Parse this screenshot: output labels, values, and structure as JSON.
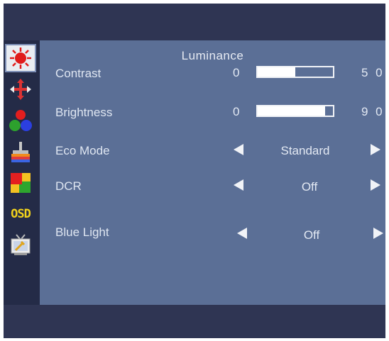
{
  "menu": {
    "title": "Luminance",
    "sidebar": [
      {
        "icon": "luminance-sun-icon",
        "active": true
      },
      {
        "icon": "position-arrows-icon",
        "active": false
      },
      {
        "icon": "color-balls-icon",
        "active": false
      },
      {
        "icon": "picture-adjust-icon",
        "active": false
      },
      {
        "icon": "color-squares-icon",
        "active": false
      },
      {
        "icon": "osd-text-icon",
        "label": "OSD",
        "active": false
      },
      {
        "icon": "tv-settings-icon",
        "active": false
      }
    ],
    "contrast": {
      "label": "Contrast",
      "min": "0",
      "value": 50,
      "display": "5 0"
    },
    "brightness": {
      "label": "Brightness",
      "min": "0",
      "value": 90,
      "display": "9 0"
    },
    "eco_mode": {
      "label": "Eco Mode",
      "value": "Standard"
    },
    "dcr": {
      "label": "DCR",
      "value": "Off"
    },
    "blue_light": {
      "label": "Blue Light",
      "value": "Off"
    }
  },
  "colors": {
    "panel": "#5b6f96",
    "frame": "#2e3553",
    "sidebar": "#242b47",
    "text": "#e3e9f3"
  }
}
